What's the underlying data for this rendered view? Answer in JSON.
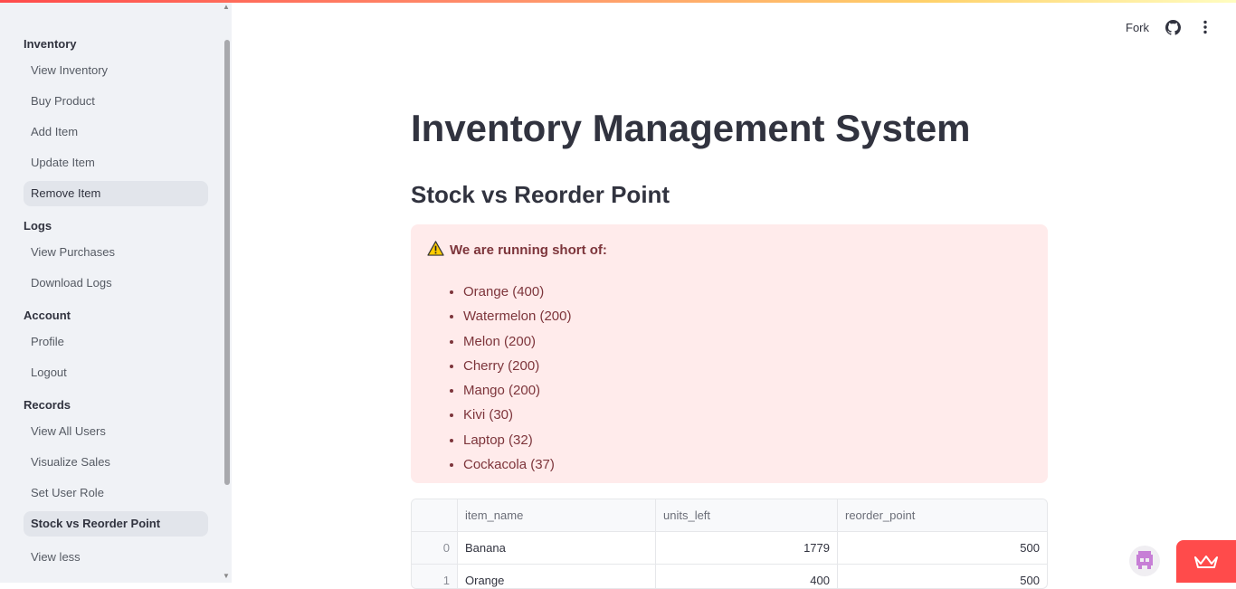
{
  "sidebar": {
    "sections": [
      {
        "title": "Inventory",
        "items": [
          "View Inventory",
          "Buy Product",
          "Add Item",
          "Update Item",
          "Remove Item"
        ]
      },
      {
        "title": "Logs",
        "items": [
          "View Purchases",
          "Download Logs"
        ]
      },
      {
        "title": "Account",
        "items": [
          "Profile",
          "Logout"
        ]
      },
      {
        "title": "Records",
        "items": [
          "View All Users",
          "Visualize Sales",
          "Set User Role",
          "Stock vs Reorder Point"
        ]
      }
    ],
    "view_less": "View less"
  },
  "header": {
    "fork_label": "Fork"
  },
  "main": {
    "title": "Inventory Management System",
    "subtitle": "Stock vs Reorder Point",
    "alert": {
      "heading": "We are running short of:",
      "items": [
        "Orange (400)",
        "Watermelon (200)",
        "Melon (200)",
        "Cherry (200)",
        "Mango (200)",
        "Kivi (30)",
        "Laptop (32)",
        "Cockacola (37)"
      ]
    },
    "table": {
      "columns": [
        "",
        "item_name",
        "units_left",
        "reorder_point"
      ],
      "rows": [
        [
          "0",
          "Banana",
          "1779",
          "500"
        ],
        [
          "1",
          "Orange",
          "400",
          "500"
        ]
      ]
    }
  },
  "colors": {
    "accent": "#ff4b4b",
    "alert_bg": "#ffebeb",
    "alert_text": "#7d353b",
    "sidebar_bg": "#f0f2f6"
  }
}
